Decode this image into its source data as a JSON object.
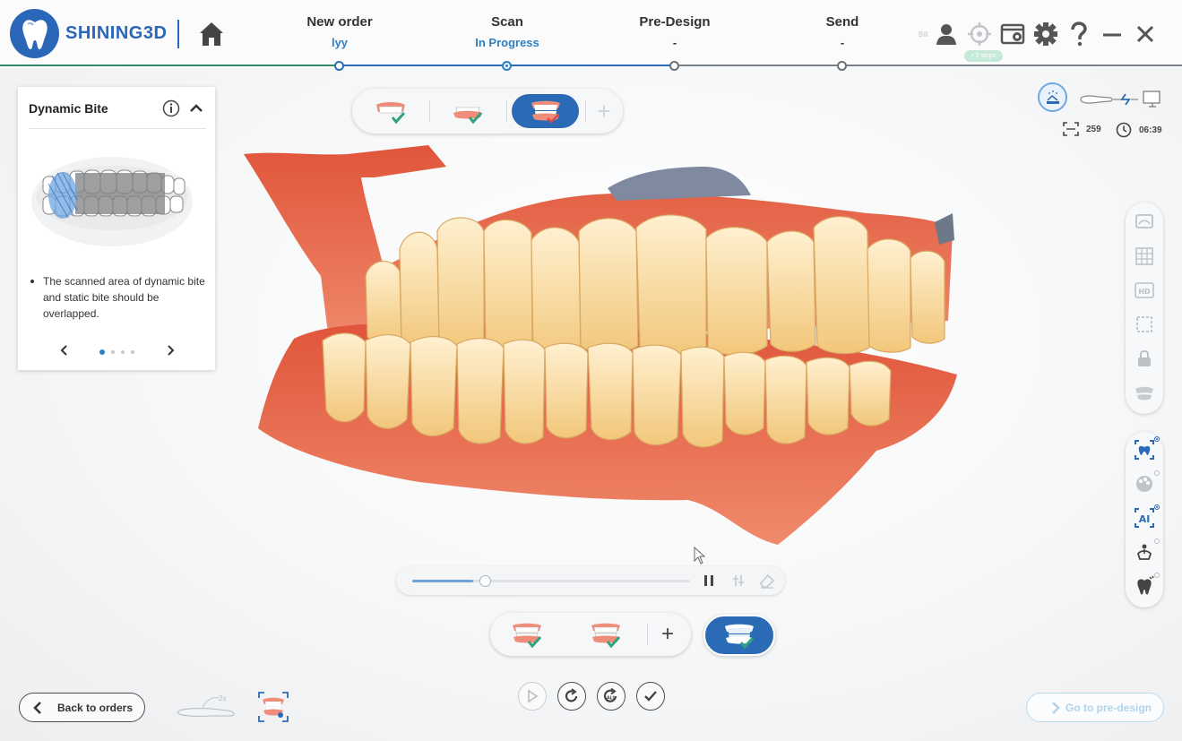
{
  "app": {
    "brand": "SHINING3D",
    "home_icon": "home-icon"
  },
  "steps": [
    {
      "title": "New order",
      "sub": "lyy",
      "state": "done"
    },
    {
      "title": "Scan",
      "sub": "In Progress",
      "state": "active"
    },
    {
      "title": "Pre-Design",
      "sub": "-",
      "state": "todo"
    },
    {
      "title": "Send",
      "sub": "-",
      "state": "todo"
    }
  ],
  "header_icons": {
    "bill_label": "Bill",
    "steps_badge": "• 3 steps",
    "icons": [
      "user-icon",
      "calibrate-icon",
      "screenshot-icon",
      "settings-icon",
      "help-icon",
      "minimize-icon",
      "close-icon"
    ]
  },
  "info_panel": {
    "title": "Dynamic Bite",
    "text": "The scanned area of dynamic bite and static bite should be overlapped.",
    "page_count": 4,
    "current_page": 1
  },
  "top_toolbar": {
    "buttons": [
      "upper-jaw-scan",
      "lower-jaw-scan",
      "bite-scan"
    ],
    "selected": "bite-scan",
    "add_label": "+"
  },
  "stats": {
    "frames": "259",
    "time": "06:39"
  },
  "side_tools_top": [
    "texture-icon",
    "texture-grid-icon",
    "hd-icon",
    "select-region-icon",
    "lock-icon",
    "jaw-icon"
  ],
  "side_tools_bottom": [
    {
      "icon": "ai-scan-icon",
      "on": true
    },
    {
      "icon": "color-icon",
      "on": false
    },
    {
      "icon": "ai-filter-icon",
      "on": true
    },
    {
      "icon": "align-icon",
      "on": false
    },
    {
      "icon": "tooth-clean-icon",
      "on": false
    }
  ],
  "playback": {
    "progress": 0.26,
    "buffered": 0.22
  },
  "bite_toolbar": {
    "buttons": [
      "bite-1",
      "bite-2"
    ],
    "add_label": "+",
    "selected": "dynamic-bite"
  },
  "bottom": {
    "back_label": "Back to orders",
    "go_label": "Go to pre-design",
    "scanner_label": "2x",
    "actions": [
      "play-icon",
      "redo-icon",
      "redo-all-icon",
      "confirm-icon"
    ]
  },
  "colors": {
    "brand_blue": "#2b67b8",
    "accent_blue": "#2b80c6",
    "done_line": "#2f8a6a"
  }
}
